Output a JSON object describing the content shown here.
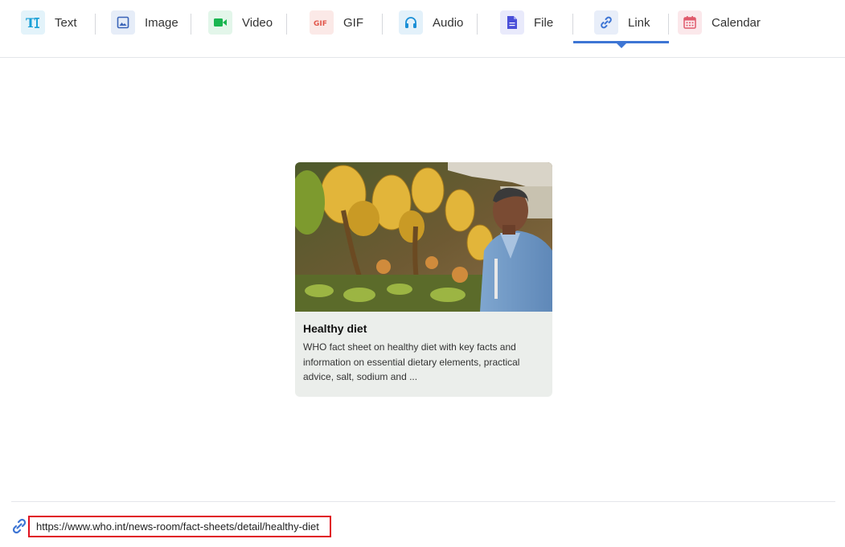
{
  "tabs": [
    {
      "id": "text",
      "label": "Text",
      "icon": "text-format-icon",
      "color": "#1aa0d6",
      "bg": "#e3f3fa"
    },
    {
      "id": "image",
      "label": "Image",
      "icon": "image-icon",
      "color": "#3a64b8",
      "bg": "#e6edf8"
    },
    {
      "id": "video",
      "label": "Video",
      "icon": "video-camera-icon",
      "color": "#19b550",
      "bg": "#e3f6ea"
    },
    {
      "id": "gif",
      "label": "GIF",
      "icon": "gif-icon",
      "color": "#e2574c",
      "bg": "#fbe9e7"
    },
    {
      "id": "audio",
      "label": "Audio",
      "icon": "headphones-icon",
      "color": "#1a8fd6",
      "bg": "#e3f1fa"
    },
    {
      "id": "file",
      "label": "File",
      "icon": "file-icon",
      "color": "#4a4fd8",
      "bg": "#e9eafb"
    },
    {
      "id": "link",
      "label": "Link",
      "icon": "link-icon",
      "color": "#3d75d4",
      "bg": "#e8eef9"
    },
    {
      "id": "calendar",
      "label": "Calendar",
      "icon": "calendar-icon",
      "color": "#e0596b",
      "bg": "#fbe8eb"
    }
  ],
  "active_tab": "Link",
  "accent_color": "#3d75d4",
  "preview": {
    "title": "Healthy diet",
    "description": "WHO fact sheet on healthy diet with key facts and information on essential dietary elements, practical advice, salt, sodium and ...",
    "image": "market-vendor-bananas-photo"
  },
  "link_input": {
    "icon": "link-icon",
    "value": "https://www.who.int/news-room/fact-sheets/detail/healthy-diet",
    "highlight_color": "#e01020"
  }
}
